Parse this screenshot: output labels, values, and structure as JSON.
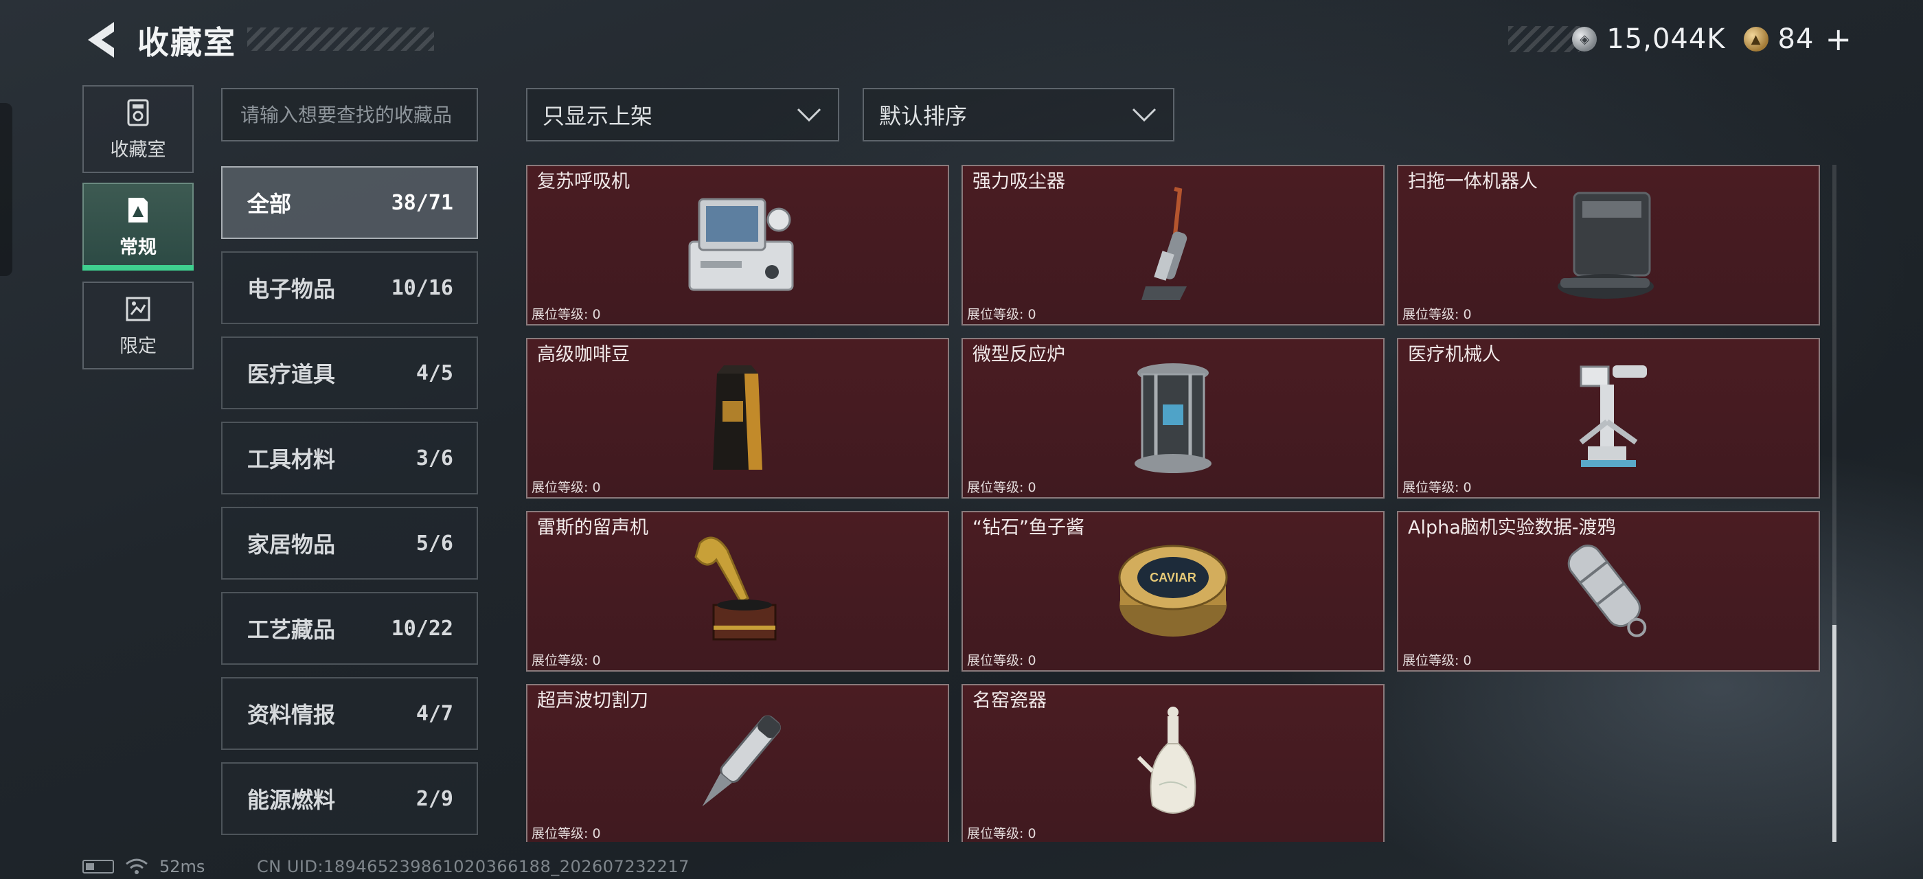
{
  "header": {
    "title": "收藏室",
    "currencies": [
      {
        "icon": "silver-coin-icon",
        "value": "15,044K"
      },
      {
        "icon": "gold-coin-icon",
        "value": "84"
      }
    ],
    "plus_label": "+"
  },
  "nav": {
    "tabs": [
      {
        "label": "收藏室",
        "icon": "collection-room-icon"
      },
      {
        "label": "常规",
        "icon": "regular-album-icon",
        "active": true
      },
      {
        "label": "限定",
        "icon": "limited-album-icon"
      }
    ]
  },
  "search": {
    "placeholder": "请输入想要查找的收藏品"
  },
  "filters": {
    "shelf_filter": "只显示上架",
    "sort": "默认排序"
  },
  "categories": [
    {
      "name": "全部",
      "count": "38/71",
      "active": true
    },
    {
      "name": "电子物品",
      "count": "10/16"
    },
    {
      "name": "医疗道具",
      "count": "4/5"
    },
    {
      "name": "工具材料",
      "count": "3/6"
    },
    {
      "name": "家居物品",
      "count": "5/6"
    },
    {
      "name": "工艺藏品",
      "count": "10/22"
    },
    {
      "name": "资料情报",
      "count": "4/7"
    },
    {
      "name": "能源燃料",
      "count": "2/9"
    }
  ],
  "items": [
    {
      "name": "复苏呼吸机",
      "level": "展位等级: 0",
      "icon": "resuscitator-icon"
    },
    {
      "name": "强力吸尘器",
      "level": "展位等级: 0",
      "icon": "vacuum-cleaner-icon"
    },
    {
      "name": "扫拖一体机器人",
      "level": "展位等级: 0",
      "icon": "robot-mop-icon"
    },
    {
      "name": "高级咖啡豆",
      "level": "展位等级: 0",
      "icon": "coffee-bean-bag-icon"
    },
    {
      "name": "微型反应炉",
      "level": "展位等级: 0",
      "icon": "mini-reactor-icon"
    },
    {
      "name": "医疗机械人",
      "level": "展位等级: 0",
      "icon": "medical-robot-icon"
    },
    {
      "name": "雷斯的留声机",
      "level": "展位等级: 0",
      "icon": "gramophone-icon"
    },
    {
      "name": "“钻石”鱼子酱",
      "level": "展位等级: 0",
      "icon": "caviar-tin-icon",
      "art_text": "CAVIAR"
    },
    {
      "name": "Alpha脑机实验数据-渡鸦",
      "level": "展位等级: 0",
      "icon": "data-capsule-icon"
    },
    {
      "name": "超声波切割刀",
      "level": "展位等级: 0",
      "icon": "ultrasonic-cutter-icon"
    },
    {
      "name": "名窑瓷器",
      "level": "展位等级: 0",
      "icon": "porcelain-vase-icon"
    }
  ],
  "status": {
    "ping": "52ms",
    "uid": "CN UID:18946523986102036618​8_202607232217"
  },
  "colors": {
    "card_bg": "#441b21",
    "accent_green": "#3fd08f",
    "text": "#e6e8ea"
  }
}
